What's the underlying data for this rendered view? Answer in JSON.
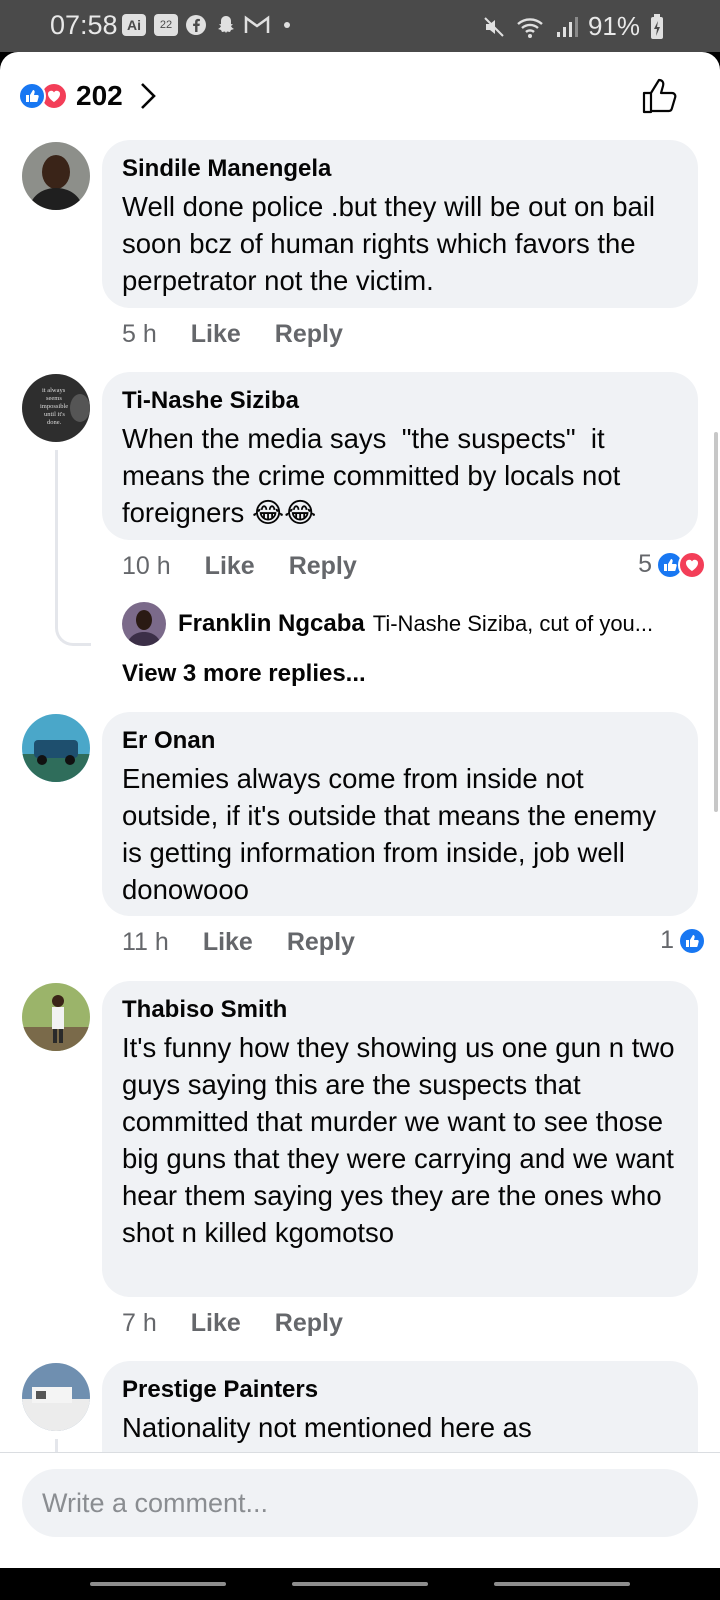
{
  "status_bar": {
    "time": "07:58",
    "notification_icons": [
      "ai-app-icon",
      "calendar-icon",
      "facebook-icon",
      "snapchat-icon",
      "gmail-icon",
      "more-dot-icon"
    ],
    "calendar_date": "22",
    "ai_label": "Ai",
    "battery": "91%"
  },
  "header": {
    "reaction_count": "202",
    "reactions": [
      "like",
      "love"
    ]
  },
  "comments": [
    {
      "author": "Sindile Manengela",
      "text": "Well done police .but they will be out on bail soon bcz of human rights which favors the perpetrator not the victim.",
      "time": "5 h",
      "like_label": "Like",
      "reply_label": "Reply"
    },
    {
      "author": "Ti-Nashe Siziba",
      "text": "When the media says  \"the suspects\"  it means the crime committed by locals not foreigners ",
      "emoji": "😂😂",
      "time": "10 h",
      "like_label": "Like",
      "reply_label": "Reply",
      "reaction_count": "5",
      "reactions": [
        "like",
        "love"
      ],
      "avatar_text": "it always seems impossible until it's done.",
      "reply_preview": {
        "author": "Franklin Ngcaba",
        "snippet": "Ti-Nashe Siziba, cut of you..."
      },
      "view_more": "View 3 more replies..."
    },
    {
      "author": "Er Onan",
      "text": "Enemies always come from inside not outside, if it's outside that means the enemy is getting information from inside, job well donowooo",
      "time": "11 h",
      "like_label": "Like",
      "reply_label": "Reply",
      "reaction_count": "1",
      "reactions": [
        "like"
      ]
    },
    {
      "author": "Thabiso Smith",
      "text": "It's funny how they showing us one gun n two guys saying this are the suspects that committed that murder we want to see those big guns that they were carrying and we want hear them saying yes they are the ones who shot n killed kgomotso",
      "time": "7 h",
      "like_label": "Like",
      "reply_label": "Reply"
    },
    {
      "author": "Prestige Painters",
      "text": "Nationality not mentioned here as"
    }
  ],
  "composer": {
    "placeholder": "Write a comment..."
  },
  "colors": {
    "like_blue": "#1877f2",
    "love_red": "#f33e58",
    "bubble_bg": "#f0f2f5",
    "meta_grey": "#65676b"
  }
}
